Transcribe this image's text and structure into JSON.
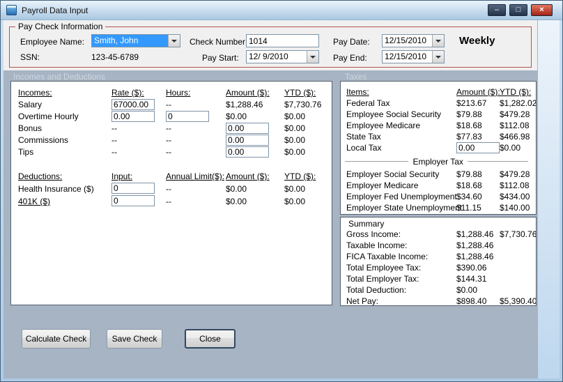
{
  "window": {
    "title": "Payroll Data Input",
    "controls": {
      "minimize": "–",
      "maximize": "□",
      "close": "×"
    }
  },
  "paycheck": {
    "legend": "Pay Check Information",
    "employee_name": {
      "label": "Employee Name:",
      "value": "Smith, John"
    },
    "ssn": {
      "label": "SSN:",
      "value": "123-45-6789"
    },
    "check_number": {
      "label": "Check Number:",
      "value": "1014"
    },
    "pay_start": {
      "label": "Pay Start:",
      "value": "12/ 9/2010"
    },
    "pay_date": {
      "label": "Pay Date:",
      "value": "12/15/2010"
    },
    "pay_end": {
      "label": "Pay End:",
      "value": "12/15/2010"
    },
    "frequency": "Weekly"
  },
  "sections": {
    "incomes_deductions": "Incomes and Deductions",
    "taxes": "Taxes"
  },
  "incomes": {
    "headers": {
      "name": "Incomes:",
      "rate": "Rate ($):",
      "hours": "Hours:",
      "amount": "Amount ($):",
      "ytd": "YTD ($):"
    },
    "rows": [
      {
        "label": "Salary",
        "rate": "67000.00",
        "hours": "--",
        "amount": "$1,288.46",
        "ytd": "$7,730.76"
      },
      {
        "label": "Overtime Hourly",
        "rate": "0.00",
        "hours": "0",
        "amount": "$0.00",
        "ytd": "$0.00"
      },
      {
        "label": "Bonus",
        "rate": "--",
        "hours": "--",
        "amount": "0.00",
        "ytd": "$0.00"
      },
      {
        "label": "Commissions",
        "rate": "--",
        "hours": "--",
        "amount": "0.00",
        "ytd": "$0.00"
      },
      {
        "label": "Tips",
        "rate": "--",
        "hours": "--",
        "amount": "0.00",
        "ytd": "$0.00"
      }
    ]
  },
  "deductions": {
    "headers": {
      "name": "Deductions:",
      "input": "Input:",
      "limit": "Annual Limit($):",
      "amount": "Amount ($):",
      "ytd": "YTD ($):"
    },
    "rows": [
      {
        "label": "Health Insurance  ($)",
        "input": "0",
        "limit": "--",
        "amount": "$0.00",
        "ytd": "$0.00"
      },
      {
        "label": "401K  ($)",
        "input": "0",
        "limit": "--",
        "amount": "$0.00",
        "ytd": "$0.00"
      }
    ]
  },
  "taxes": {
    "headers": {
      "items": "Items:",
      "amount": "Amount ($):",
      "ytd": "YTD ($):"
    },
    "employee_rows": [
      {
        "label": "Federal Tax",
        "amount": "$213.67",
        "ytd": "$1,282.02"
      },
      {
        "label": "Employee Social Security",
        "amount": "$79.88",
        "ytd": "$479.28"
      },
      {
        "label": "Employee Medicare",
        "amount": "$18.68",
        "ytd": "$112.08"
      },
      {
        "label": "State Tax",
        "amount": "$77.83",
        "ytd": "$466.98"
      }
    ],
    "local_tax": {
      "label": "Local Tax",
      "amount": "0.00",
      "ytd": "$0.00"
    },
    "employer_header": "Employer Tax",
    "employer_rows": [
      {
        "label": "Employer Social Security",
        "amount": "$79.88",
        "ytd": "$479.28"
      },
      {
        "label": "Employer Medicare",
        "amount": "$18.68",
        "ytd": "$112.08"
      },
      {
        "label": "Employer Fed Unemployment",
        "amount": "$34.60",
        "ytd": "$434.00"
      },
      {
        "label": "Employer State Unemployment",
        "amount": "$11.15",
        "ytd": "$140.00"
      }
    ]
  },
  "summary": {
    "legend": "Summary",
    "rows": [
      {
        "label": "Gross Income:",
        "amount": "$1,288.46",
        "ytd": "$7,730.76"
      },
      {
        "label": "Taxable Income:",
        "amount": "$1,288.46",
        "ytd": ""
      },
      {
        "label": "FICA Taxable Income:",
        "amount": "$1,288.46",
        "ytd": ""
      },
      {
        "label": "Total Employee Tax:",
        "amount": "$390.06",
        "ytd": ""
      },
      {
        "label": "Total Employer Tax:",
        "amount": "$144.31",
        "ytd": ""
      },
      {
        "label": "Total Deduction:",
        "amount": "$0.00",
        "ytd": ""
      },
      {
        "label": "Net Pay:",
        "amount": "$898.40",
        "ytd": "$5,390.40"
      }
    ]
  },
  "buttons": {
    "calculate": "Calculate Check",
    "save": "Save Check",
    "close": "Close"
  }
}
